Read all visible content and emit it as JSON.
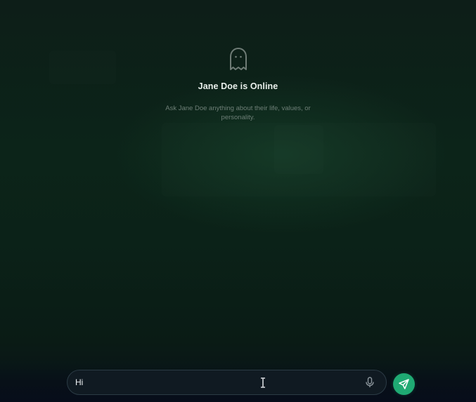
{
  "hero": {
    "icon": "ghost-icon",
    "title": "Jane Doe is Online",
    "subtitle": "Ask Jane Doe anything about their life, values, or personality."
  },
  "composer": {
    "input_value": "Hi",
    "mic_icon": "microphone-icon",
    "send_icon": "send-icon"
  },
  "colors": {
    "accent": "#1faa73",
    "background": "#0c2419",
    "input_border": "#2b3b45",
    "subtitle_text": "#6e7f77"
  }
}
